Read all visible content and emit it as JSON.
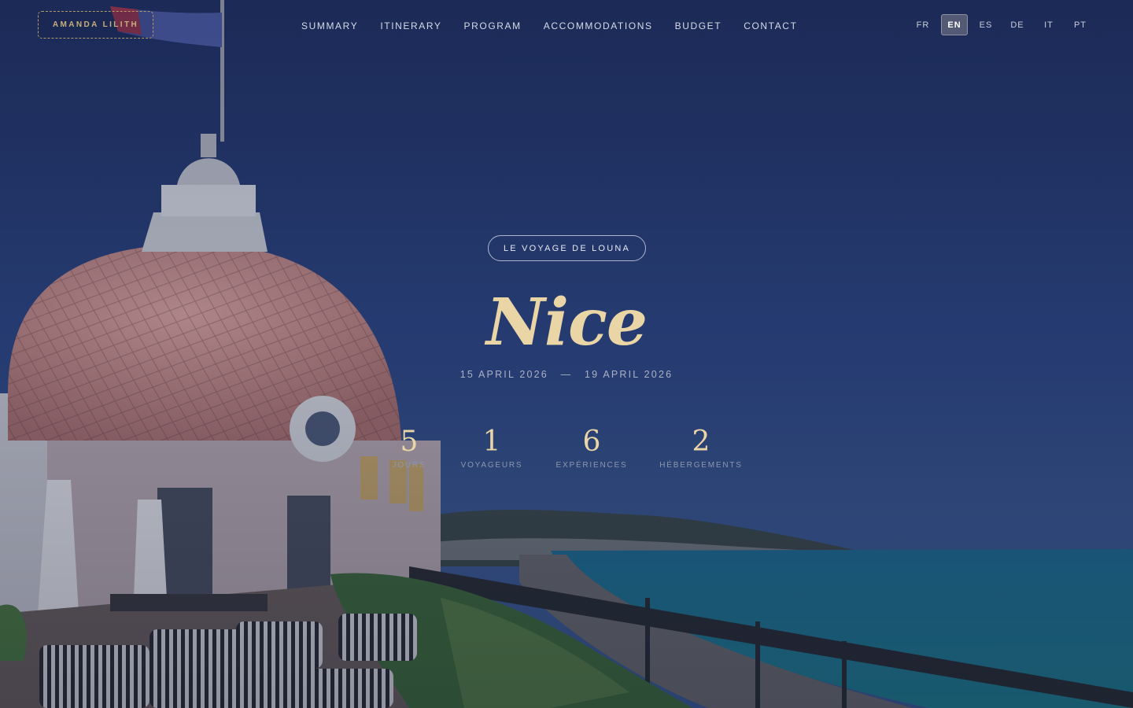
{
  "brand": {
    "name": "AMANDA LILITH"
  },
  "nav": {
    "items": [
      "SUMMARY",
      "ITINERARY",
      "PROGRAM",
      "ACCOMMODATIONS",
      "BUDGET",
      "CONTACT"
    ]
  },
  "languages": {
    "options": [
      "FR",
      "EN",
      "ES",
      "DE",
      "IT",
      "PT"
    ],
    "active": "EN"
  },
  "hero": {
    "badge": "LE VOYAGE DE LOUNA",
    "title": "Nice",
    "date_start": "15 APRIL 2026",
    "date_separator": "—",
    "date_end": "19 APRIL 2026",
    "stats": [
      {
        "value": "5",
        "label": "JOURS"
      },
      {
        "value": "1",
        "label": "VOYAGEURS"
      },
      {
        "value": "6",
        "label": "EXPÉRIENCES"
      },
      {
        "value": "2",
        "label": "HÉBERGEMENTS"
      }
    ]
  },
  "colors": {
    "accent_gold": "#e9d5a6",
    "sky": "#223a6e",
    "sea": "#1f7a96",
    "dome": "#c98b86"
  }
}
